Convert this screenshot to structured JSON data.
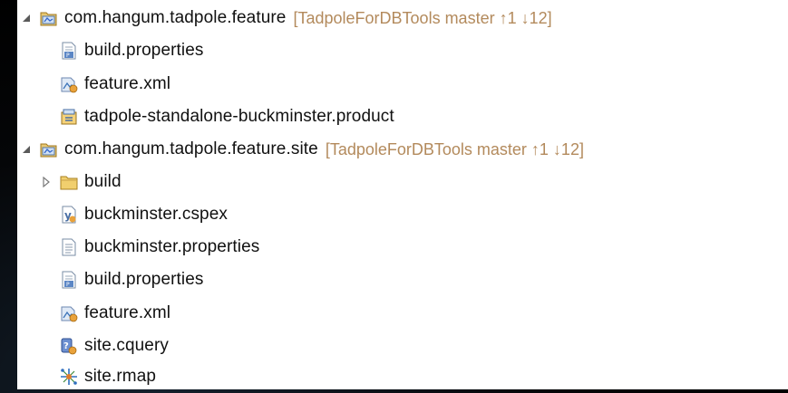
{
  "tree": {
    "items": [
      {
        "label": "com.hangum.tadpole.feature",
        "decoration": "[TadpoleForDBTools master ↑1 ↓12]",
        "level": 0,
        "expanded": true,
        "icon": "feature-project-icon"
      },
      {
        "label": "build.properties",
        "level": 1,
        "icon": "properties-file-icon"
      },
      {
        "label": "feature.xml",
        "level": 1,
        "icon": "feature-xml-icon"
      },
      {
        "label": "tadpole-standalone-buckminster.product",
        "level": 1,
        "icon": "product-file-icon"
      },
      {
        "label": "com.hangum.tadpole.feature.site",
        "decoration": "[TadpoleForDBTools master ↑1 ↓12]",
        "level": 0,
        "expanded": true,
        "icon": "feature-project-icon"
      },
      {
        "label": "build",
        "level": 1,
        "collapsed": true,
        "icon": "folder-icon"
      },
      {
        "label": "buckminster.cspex",
        "level": 1,
        "icon": "cspex-file-icon"
      },
      {
        "label": "buckminster.properties",
        "level": 1,
        "icon": "text-file-icon"
      },
      {
        "label": "build.properties",
        "level": 1,
        "icon": "properties-file-icon"
      },
      {
        "label": "feature.xml",
        "level": 1,
        "icon": "feature-xml-icon"
      },
      {
        "label": "site.cquery",
        "level": 1,
        "icon": "cquery-file-icon"
      },
      {
        "label": "site.rmap",
        "level": 1,
        "icon": "rmap-file-icon"
      }
    ]
  }
}
